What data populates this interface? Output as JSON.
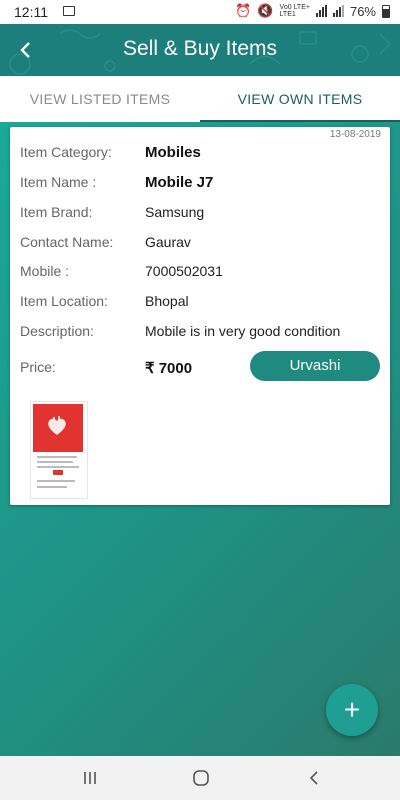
{
  "status_bar": {
    "time": "12:11",
    "network_top": "Vo0 LTE+",
    "network_bottom": "LTE1",
    "battery": "76%"
  },
  "app_bar": {
    "title": "Sell & Buy Items",
    "back_icon": "back-arrow-icon"
  },
  "tabs": [
    {
      "label": "VIEW LISTED ITEMS",
      "active": false
    },
    {
      "label": "VIEW OWN ITEMS",
      "active": true
    }
  ],
  "item": {
    "date": "13-08-2019",
    "fields": [
      {
        "label": "Item Category:",
        "value": "Mobiles"
      },
      {
        "label": "Item Name :",
        "value": "Mobile J7"
      },
      {
        "label": "Item Brand:",
        "value": "Samsung"
      },
      {
        "label": "Contact Name:",
        "value": "Gaurav"
      },
      {
        "label": "Mobile :",
        "value": "7000502031"
      },
      {
        "label": "Item Location:",
        "value": "Bhopal"
      },
      {
        "label": "Description:",
        "value": "Mobile is in very good condition"
      },
      {
        "label": "Price:",
        "value": "₹ 7000"
      }
    ],
    "buyer_button": "Urvashi"
  },
  "fab_icon": "plus-icon",
  "colors": {
    "primary": "#1c7f7b",
    "accent": "#1f8a80",
    "tab_active": "#1a5f5a"
  }
}
